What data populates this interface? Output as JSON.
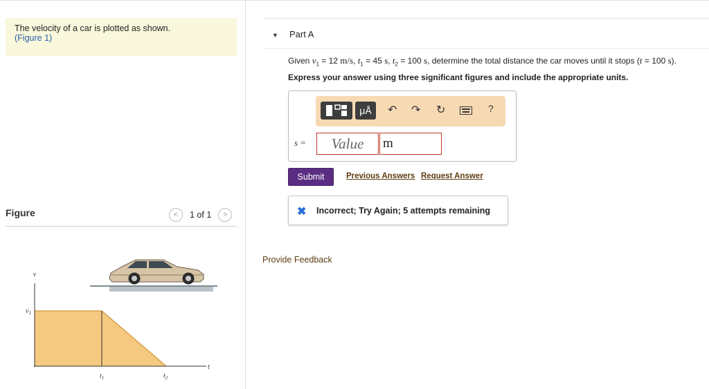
{
  "problem": {
    "statement": "The velocity of a car is plotted as shown.",
    "figure_link": "(Figure 1)"
  },
  "figure": {
    "label": "Figure",
    "pager": "1 of 1",
    "prev_icon": "chevron-left-icon",
    "next_icon": "chevron-right-icon",
    "axis_v": "v",
    "axis_v1": "v",
    "axis_v1_sub": "1",
    "axis_t": "t",
    "tick_t1": "t",
    "tick_t1_sub": "1",
    "tick_t2": "t",
    "tick_t2_sub": "2",
    "fill_color": "#f5c97f",
    "line_color": "#d9a24a"
  },
  "partA": {
    "title": "Part A",
    "given": {
      "g1": "Given ",
      "v": "v",
      "v_sub": "1",
      "g2": " = 12 ",
      "u1": "m/s",
      "g3": ", ",
      "t1": "t",
      "t1_sub": "1",
      "g4": " = 45 ",
      "u2": "s",
      "g5": ", ",
      "t2": "t",
      "t2_sub": "2",
      "g6": " = 100 ",
      "u3": "s",
      "g7": ", determine the total distance the car moves until it stops (",
      "t": "t",
      "g8": " = 100 ",
      "u4": "s",
      "g9": ")."
    },
    "instruction": "Express your answer using three significant figures and include the appropriate units."
  },
  "answer": {
    "toolbar": {
      "template_icon": "template-icon",
      "units_label": "μÅ",
      "undo_icon": "undo-icon",
      "redo_icon": "redo-icon",
      "reset_icon": "reset-icon",
      "keyboard_icon": "keyboard-icon",
      "help_label": "?"
    },
    "variable": "s =",
    "value_placeholder": "Value",
    "unit_value": "m"
  },
  "actions": {
    "submit": "Submit",
    "previous_answers": "Previous Answers",
    "request_answer": "Request Answer"
  },
  "feedback": {
    "icon": "x-icon",
    "message": "Incorrect; Try Again; 5 attempts remaining",
    "accent": "#2a6fd6"
  },
  "provide_feedback": "Provide Feedback",
  "colors": {
    "submit_bg": "#5a2d82",
    "toolbar_bg": "#f7d9b3",
    "problem_bg": "#f9f7dc",
    "input_border": "#c0392b"
  }
}
